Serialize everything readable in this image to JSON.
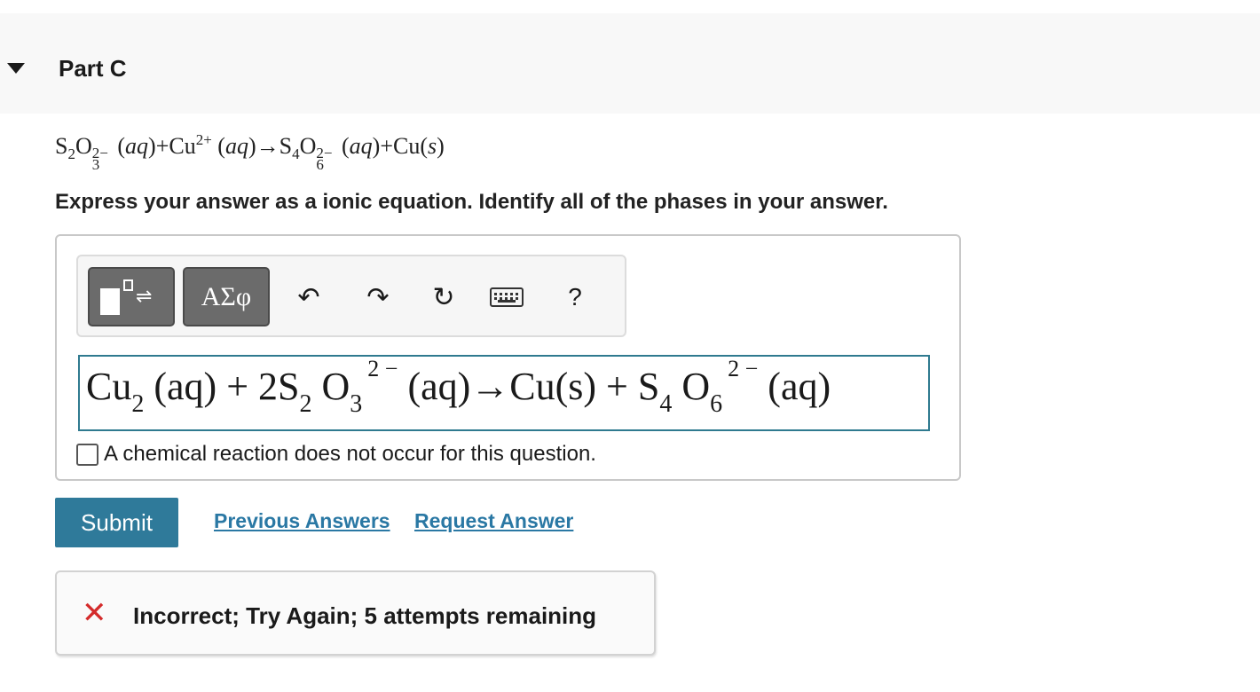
{
  "part": {
    "title": "Part C"
  },
  "question": {
    "eq_s2o3": "S₂O",
    "eq_s2o3_charge": "2−",
    "eq_s2o3_sub": "3",
    "aq": "aq",
    "plus": "+",
    "cu": "Cu",
    "cu_charge": "2+",
    "arrow": "→",
    "s4o6": "S₄O",
    "s4o6_charge": "2−",
    "s4o6_sub": "6",
    "cu_s": "Cu(",
    "s": "s",
    "close": ")",
    "open": "(",
    "instructions": "Express your answer as a ionic equation. Identify all of the phases in your answer."
  },
  "toolbar": {
    "greek_label": "ΑΣφ",
    "undo_glyph": "↶",
    "redo_glyph": "↷",
    "reset_glyph": "↻",
    "help_label": "?",
    "icons": [
      "templates-icon",
      "greek-symbols-icon",
      "undo-icon",
      "redo-icon",
      "reset-icon",
      "keyboard-icon",
      "help-icon"
    ]
  },
  "answer": {
    "t1": "Cu",
    "t1_sub": "2",
    "t2": " (aq) + 2S",
    "t2_sub": "2",
    "t3": " O",
    "t3_sub": "3",
    "t3_sup": "2 −",
    "t4": " (aq)→Cu(s) + S",
    "t4_sub": "4",
    "t5": " O",
    "t5_sub": "6",
    "t5_sup": "2 −",
    "t6": " (aq)"
  },
  "no_reaction_label": "A chemical reaction does not occur for this question.",
  "actions": {
    "submit": "Submit",
    "previous_answers": "Previous Answers",
    "request_answer": "Request Answer"
  },
  "feedback": {
    "icon": "✕",
    "message": "Incorrect; Try Again; 5 attempts remaining"
  },
  "colors": {
    "submit_bg": "#2f7a9a",
    "link": "#2a78a4",
    "input_border": "#2f7a8f",
    "error": "#d42b2b"
  }
}
